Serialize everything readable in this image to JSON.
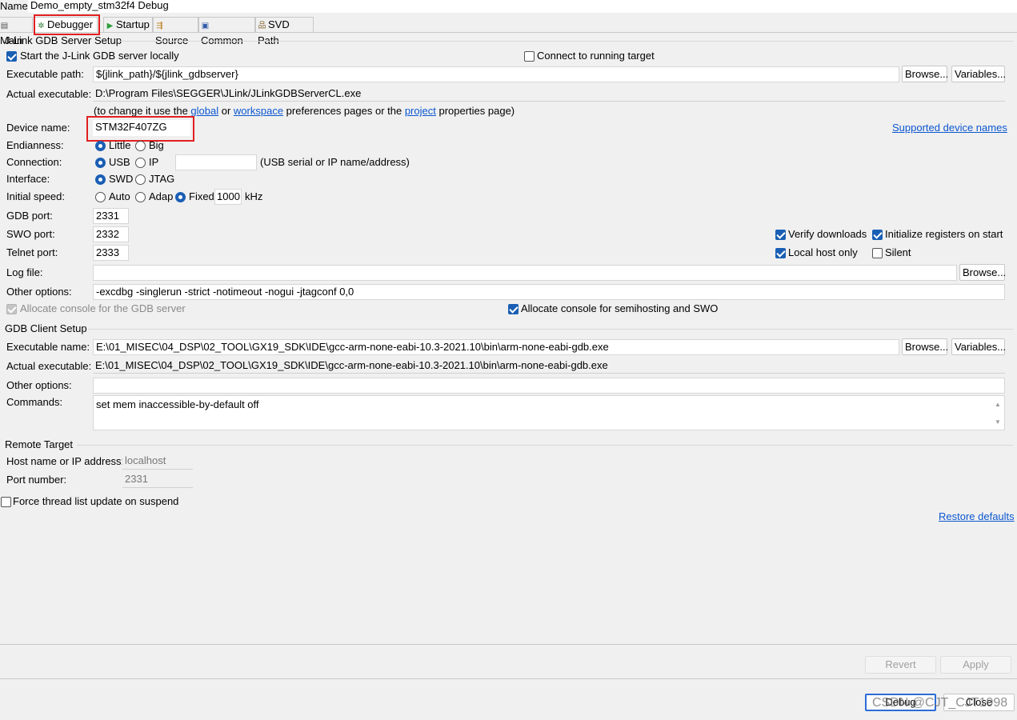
{
  "header": {
    "name_label": "Name:",
    "name_value": "Demo_empty_stm32f4 Debug"
  },
  "tabs": [
    {
      "label": "Main",
      "icon": "page-icon"
    },
    {
      "label": "Debugger",
      "icon": "bug-icon"
    },
    {
      "label": "Startup",
      "icon": "play-icon"
    },
    {
      "label": "Source",
      "icon": "source-icon"
    },
    {
      "label": "Common",
      "icon": "common-icon"
    },
    {
      "label": "SVD Path",
      "icon": "tree-icon"
    }
  ],
  "jlink": {
    "group_title": "J-Link GDB Server Setup",
    "start_locally": "Start the J-Link GDB server locally",
    "connect_running": "Connect to running target",
    "exec_path_label": "Executable path:",
    "exec_path_value": "${jlink_path}/${jlink_gdbserver}",
    "actual_exec_label": "Actual executable:",
    "actual_exec_value": "D:\\Program Files\\SEGGER\\JLink/JLinkGDBServerCL.exe",
    "note_prefix": "(to change it use the ",
    "note_global": "global",
    "note_or": " or ",
    "note_workspace": "workspace",
    "note_mid": " preferences pages or the ",
    "note_project": "project",
    "note_suffix": " properties page)",
    "device_label": "Device name:",
    "device_value": "STM32F407ZG",
    "supported_devices": "Supported device names",
    "endianness_label": "Endianness:",
    "endian_little": "Little",
    "endian_big": "Big",
    "connection_label": "Connection:",
    "conn_usb": "USB",
    "conn_ip": "IP",
    "conn_value": "",
    "conn_hint": "(USB serial or IP name/address)",
    "interface_label": "Interface:",
    "if_swd": "SWD",
    "if_jtag": "JTAG",
    "speed_label": "Initial speed:",
    "speed_auto": "Auto",
    "speed_adap": "Adap",
    "speed_fixed": "Fixed",
    "speed_value": "1000",
    "speed_unit": "kHz",
    "gdb_port_label": "GDB port:",
    "gdb_port_value": "2331",
    "swo_port_label": "SWO port:",
    "swo_port_value": "2332",
    "telnet_port_label": "Telnet port:",
    "telnet_port_value": "2333",
    "verify_downloads": "Verify downloads",
    "init_registers": "Initialize registers on start",
    "local_host_only": "Local host only",
    "silent": "Silent",
    "log_file_label": "Log file:",
    "log_file_value": "",
    "other_options_label": "Other options:",
    "other_options_value": "-excdbg -singlerun -strict -notimeout -nogui -jtagconf 0,0",
    "alloc_console_gdb": "Allocate console for the GDB server",
    "alloc_console_semi": "Allocate console for semihosting and SWO"
  },
  "gdbclient": {
    "group_title": "GDB Client Setup",
    "exec_name_label": "Executable name:",
    "exec_name_value": "E:\\01_MISEC\\04_DSP\\02_TOOL\\GX19_SDK\\IDE\\gcc-arm-none-eabi-10.3-2021.10\\bin\\arm-none-eabi-gdb.exe",
    "actual_exec_label": "Actual executable:",
    "actual_exec_value": "E:\\01_MISEC\\04_DSP\\02_TOOL\\GX19_SDK\\IDE\\gcc-arm-none-eabi-10.3-2021.10\\bin\\arm-none-eabi-gdb.exe",
    "other_options_label": "Other options:",
    "other_options_value": "",
    "commands_label": "Commands:",
    "commands_value": "set mem inaccessible-by-default off"
  },
  "remote": {
    "group_title": "Remote Target",
    "host_label": "Host name or IP address:",
    "host_value": "localhost",
    "port_label": "Port number:",
    "port_value": "2331"
  },
  "force_thread": "Force thread list update on suspend",
  "restore_defaults": "Restore defaults",
  "buttons": {
    "browse": "Browse...",
    "variables": "Variables...",
    "revert": "Revert",
    "apply": "Apply",
    "debug": "Debug",
    "close": "Close"
  },
  "watermark": "CSDN @CJT_CJT1998",
  "colors": {
    "accent": "#1a5fb4",
    "link": "#0b57d0",
    "highlight": "#e02020"
  }
}
